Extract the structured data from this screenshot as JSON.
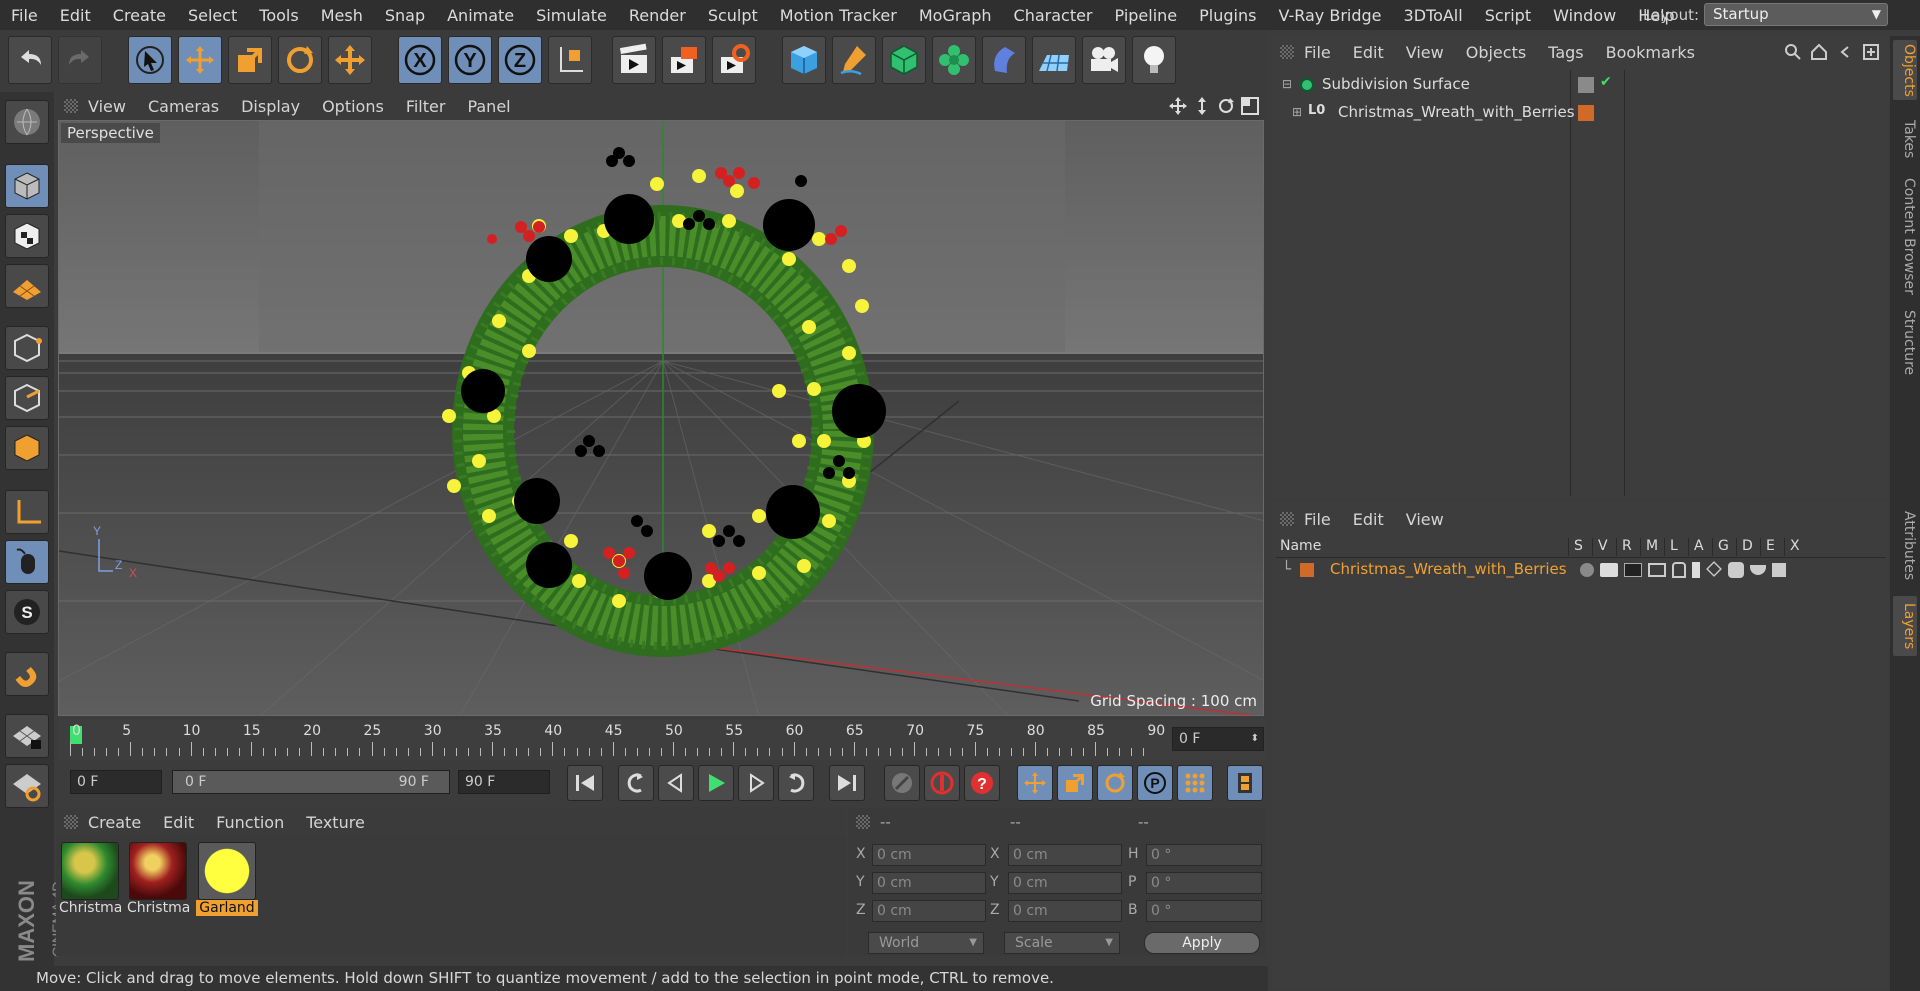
{
  "menubar": [
    "File",
    "Edit",
    "Create",
    "Select",
    "Tools",
    "Mesh",
    "Snap",
    "Animate",
    "Simulate",
    "Render",
    "Sculpt",
    "Motion Tracker",
    "MoGraph",
    "Character",
    "Pipeline",
    "Plugins",
    "V-Ray Bridge",
    "3DToAll",
    "Script",
    "Window",
    "Help"
  ],
  "layout": {
    "label": "Layout:",
    "value": "Startup"
  },
  "viewport": {
    "menu": [
      "View",
      "Cameras",
      "Display",
      "Options",
      "Filter",
      "Panel"
    ],
    "camera_label": "Perspective",
    "grid_spacing": "Grid Spacing : 100 cm",
    "axis_y": "Y",
    "axis_z": "Z",
    "axis_x": "X"
  },
  "timeline": {
    "ticks": [
      "0",
      "5",
      "10",
      "15",
      "20",
      "25",
      "30",
      "35",
      "40",
      "45",
      "50",
      "55",
      "60",
      "65",
      "70",
      "75",
      "80",
      "85",
      "90"
    ],
    "current_frame": "0 F",
    "start": "0 F",
    "range_start": "0 F",
    "range_end": "90 F",
    "end": "90 F"
  },
  "materials": {
    "menu": [
      "Create",
      "Edit",
      "Function",
      "Texture"
    ],
    "items": [
      {
        "label": "Christma",
        "colors": [
          "#2f8a2f",
          "#d7c64a"
        ]
      },
      {
        "label": "Christma",
        "colors": [
          "#7a1a1a",
          "#d8b040"
        ]
      },
      {
        "label": "Garland",
        "colors": [
          "#ffff40",
          "#e6d000"
        ]
      }
    ]
  },
  "coordinates": {
    "headers": [
      "--",
      "--",
      "--"
    ],
    "rows": [
      {
        "a": "X",
        "av": "0 cm",
        "b": "X",
        "bv": "0 cm",
        "c": "H",
        "cv": "0 °"
      },
      {
        "a": "Y",
        "av": "0 cm",
        "b": "Y",
        "bv": "0 cm",
        "c": "P",
        "cv": "0 °"
      },
      {
        "a": "Z",
        "av": "0 cm",
        "b": "Z",
        "bv": "0 cm",
        "c": "B",
        "cv": "0 °"
      }
    ],
    "mode": "World",
    "transform": "Scale",
    "apply": "Apply"
  },
  "status": "Move: Click and drag to move elements. Hold down SHIFT to quantize movement / add to the selection in point mode, CTRL to remove.",
  "objects": {
    "menu": [
      "File",
      "Edit",
      "View",
      "Objects",
      "Tags",
      "Bookmarks"
    ],
    "items": [
      {
        "name": "Subdivision Surface"
      },
      {
        "name": "Christmas_Wreath_with_Berries",
        "layer_color": "#d06a28"
      }
    ]
  },
  "layers": {
    "menu": [
      "File",
      "Edit",
      "View"
    ],
    "columns": [
      "Name",
      "S",
      "V",
      "R",
      "M",
      "L",
      "A",
      "G",
      "D",
      "E",
      "X"
    ],
    "items": [
      {
        "name": "Christmas_Wreath_with_Berries",
        "color": "#d06a28"
      }
    ]
  },
  "sidetabs": [
    "Objects",
    "Takes",
    "Content Browser",
    "Structure",
    "Attributes",
    "Layers"
  ],
  "logo": {
    "brand": "MAXON",
    "product": "CINEMA 4D"
  },
  "colors": {
    "accent": "#f0a030",
    "highlight": "#6f8fb8",
    "selected_text": "#f0a030"
  }
}
